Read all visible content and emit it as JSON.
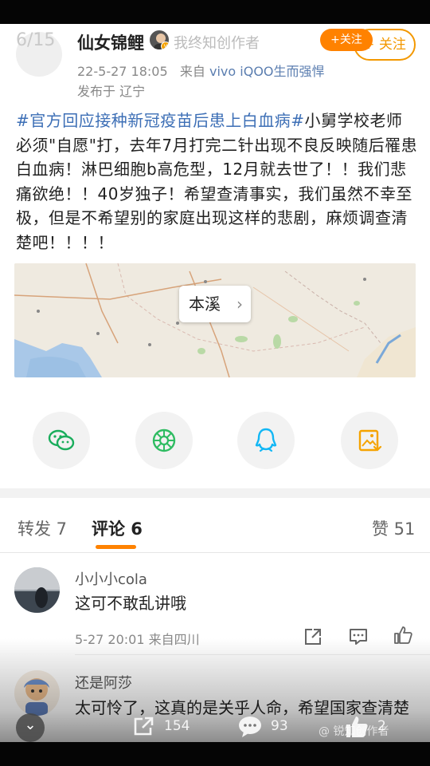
{
  "viewer": {
    "page_counter": "6/15"
  },
  "post": {
    "author": "仙女锦鲤",
    "author_overlay": "我终知创作者",
    "follow_label": "+关注",
    "follow_label_ghost": "+ 关注",
    "date": "22-5-27 18:05",
    "source_prefix": "来自",
    "source": "vivo iQOO生而强悍",
    "location": "发布于 辽宁",
    "hashtag": "#官方回应接种新冠疫苗后患上白血病#",
    "body": "小舅学校老师必须\"自愿\"打，去年7月打完二针出现不良反映随后罹患白血病！淋巴细胞b高危型，12月就去世了！！我们悲痛欲绝！！40岁独子！希望查清事实，我们虽然不幸至极，但是不希望别的家庭出现这样的悲剧，麻烦调查清楚吧！！！！",
    "map_location": "本溪",
    "map_chevron": "›"
  },
  "share": {
    "items": [
      {
        "icon": "wechat-icon"
      },
      {
        "icon": "moments-icon"
      },
      {
        "icon": "qq-icon"
      },
      {
        "icon": "save-image-icon"
      }
    ]
  },
  "tabs": {
    "repost": "转发 7",
    "comments": "评论 6",
    "likes": "赞 51"
  },
  "comments": [
    {
      "name": "小小小cola",
      "text": "这可不敢乱讲哦",
      "meta": "5-27 20:01  来自四川"
    },
    {
      "name": "还是阿莎",
      "text": "太可怜了，这真的是关乎人命，希望国家查清楚"
    }
  ],
  "bottom": {
    "expand": "⌄",
    "reposts": "154",
    "comments": "93",
    "likes": "2",
    "watermark": "@ 锐知创作者"
  },
  "colors": {
    "accent": "#ff8200",
    "link": "#3d6fb6"
  }
}
